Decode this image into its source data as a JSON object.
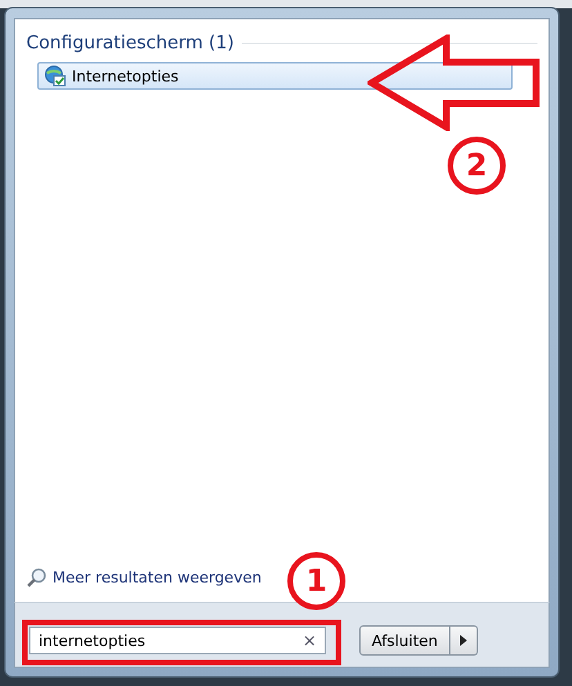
{
  "results": {
    "heading": "Configuratiescherm (1)",
    "items": [
      {
        "label": "Internetopties",
        "selected": true
      }
    ]
  },
  "more_results": "Meer resultaten weergeven",
  "search": {
    "value": "internetopties",
    "clear": "×"
  },
  "shutdown": {
    "label": "Afsluiten"
  },
  "annotations": [
    {
      "label": "2"
    },
    {
      "label": "1"
    }
  ]
}
